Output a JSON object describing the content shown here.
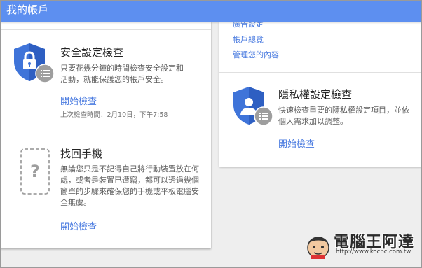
{
  "header": {
    "title": "我的帳戶"
  },
  "security_check": {
    "title": "安全設定檢查",
    "description": "只要花幾分鐘的時間檢查安全設定和活動，就能保護您的帳戶安全。",
    "action": "開始檢查",
    "last_checked": "上次檢查時間：2月10日，下午7:58"
  },
  "find_phone": {
    "title": "找回手機",
    "description": "無論您只是不記得自己將行動裝置放在何處，或者是裝置已遭竊，都可以透過幾個簡單的步驟來確保您的手機或平板電腦安全無虞。",
    "action": "開始檢查"
  },
  "right_links": [
    "廣告設定",
    "帳戶總覽",
    "管理您的內容"
  ],
  "privacy_check": {
    "title": "隱私權設定檢查",
    "description": "快速檢查重要的隱私權設定項目，並依個人需求加以調整。",
    "action": "開始檢查"
  },
  "watermark": {
    "title": "電腦王阿達",
    "url": "http://www.kocpc.com.tw"
  },
  "colors": {
    "header_bg": "#5d8ff0",
    "link": "#4a7be0",
    "shield_blue": "#3f74d9",
    "badge_gray": "#9e9e9e"
  },
  "icons": {
    "security": "shield-lock-icon",
    "phone": "phone-question-icon",
    "privacy": "shield-person-icon",
    "list_badge": "list-badge-icon"
  }
}
